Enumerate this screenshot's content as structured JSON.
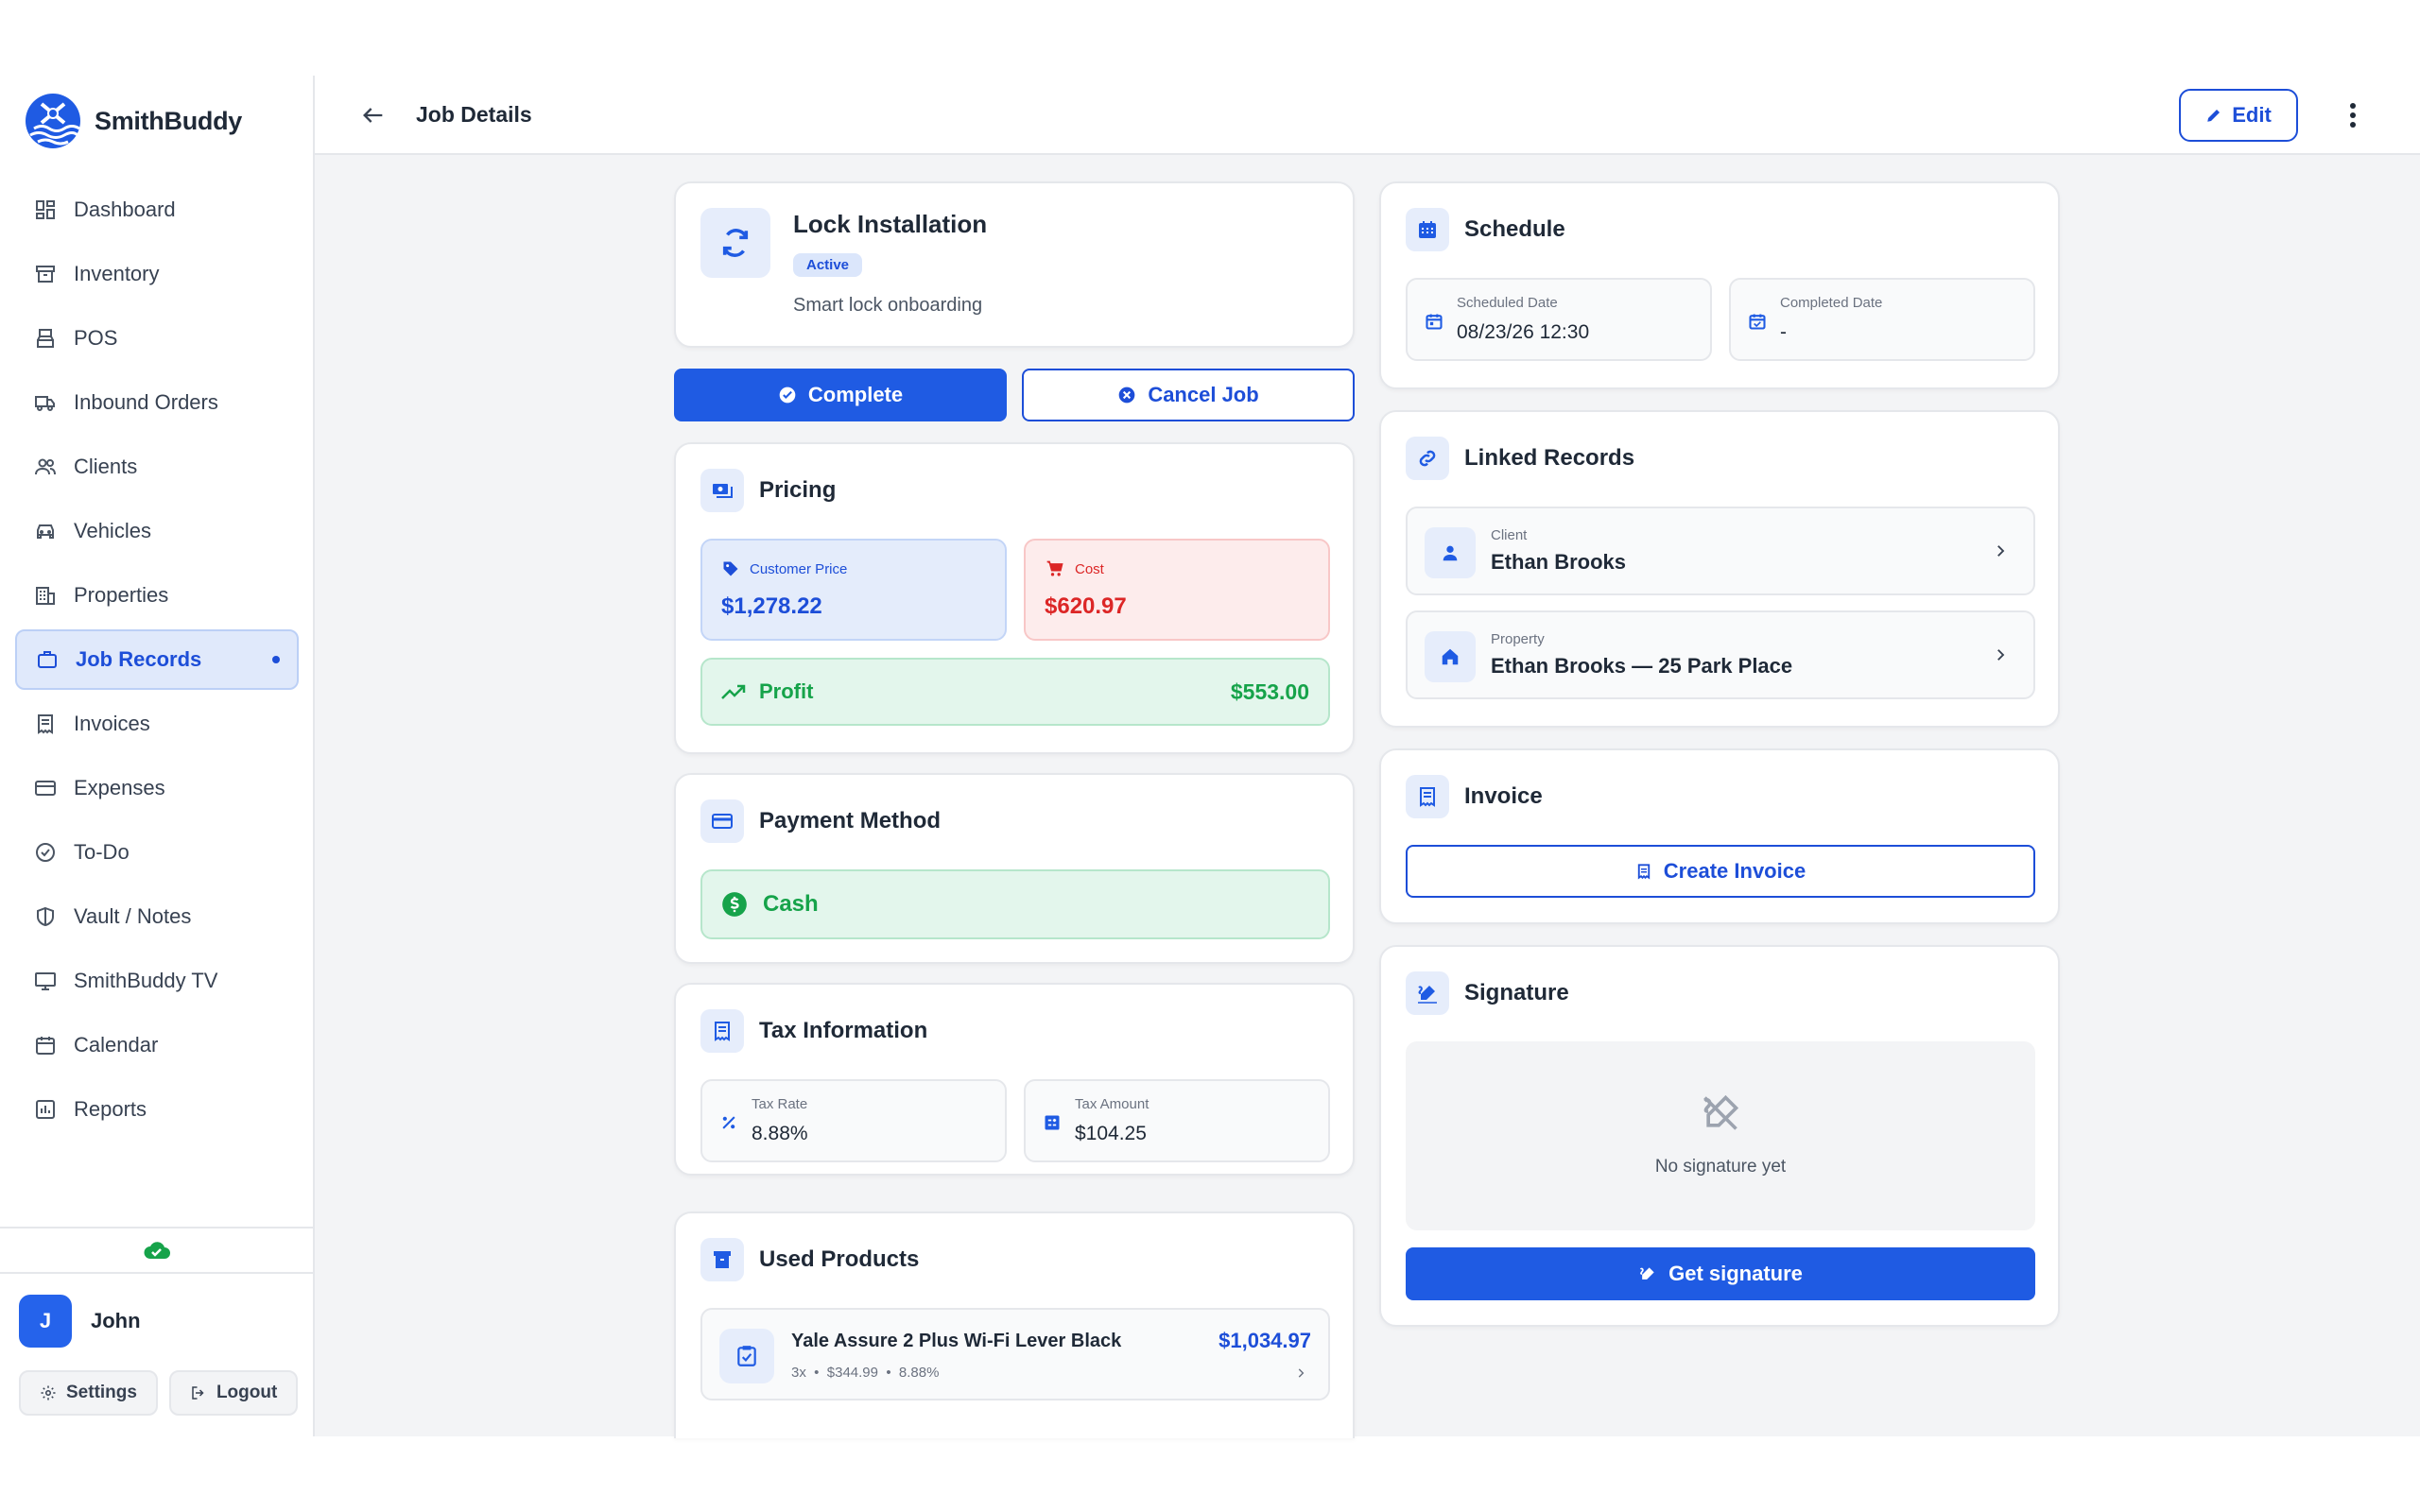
{
  "brand": {
    "name": "SmithBuddy"
  },
  "sidebar": {
    "items": [
      {
        "label": "Dashboard",
        "icon": "dashboard-icon"
      },
      {
        "label": "Inventory",
        "icon": "archive-icon"
      },
      {
        "label": "POS",
        "icon": "register-icon"
      },
      {
        "label": "Inbound Orders",
        "icon": "truck-icon"
      },
      {
        "label": "Clients",
        "icon": "users-icon"
      },
      {
        "label": "Vehicles",
        "icon": "car-icon"
      },
      {
        "label": "Properties",
        "icon": "building-icon"
      },
      {
        "label": "Job Records",
        "icon": "briefcase-icon",
        "active": true
      },
      {
        "label": "Invoices",
        "icon": "receipt-icon"
      },
      {
        "label": "Expenses",
        "icon": "card-icon"
      },
      {
        "label": "To-Do",
        "icon": "check-circle-icon"
      },
      {
        "label": "Vault / Notes",
        "icon": "shield-icon"
      },
      {
        "label": "SmithBuddy TV",
        "icon": "monitor-icon"
      },
      {
        "label": "Calendar",
        "icon": "calendar-icon"
      },
      {
        "label": "Reports",
        "icon": "chart-icon"
      }
    ],
    "user": {
      "initial": "J",
      "name": "John"
    },
    "settings_label": "Settings",
    "logout_label": "Logout"
  },
  "header": {
    "title": "Job Details",
    "edit_label": "Edit"
  },
  "job": {
    "title": "Lock Installation",
    "status": "Active",
    "description": "Smart lock onboarding"
  },
  "actions": {
    "complete_label": "Complete",
    "cancel_label": "Cancel Job"
  },
  "pricing": {
    "title": "Pricing",
    "customer_price_label": "Customer Price",
    "customer_price": "$1,278.22",
    "cost_label": "Cost",
    "cost": "$620.97",
    "profit_label": "Profit",
    "profit": "$553.00"
  },
  "payment": {
    "title": "Payment Method",
    "method": "Cash"
  },
  "tax": {
    "title": "Tax Information",
    "rate_label": "Tax Rate",
    "rate": "8.88%",
    "amount_label": "Tax Amount",
    "amount": "$104.25"
  },
  "products": {
    "title": "Used Products",
    "items": [
      {
        "name": "Yale Assure 2 Plus Wi-Fi Lever Black",
        "details": "3x  •  $344.99  •  8.88%",
        "total": "$1,034.97"
      }
    ]
  },
  "schedule": {
    "title": "Schedule",
    "scheduled_label": "Scheduled Date",
    "scheduled": "08/23/26 12:30",
    "completed_label": "Completed Date",
    "completed": "-"
  },
  "linked": {
    "title": "Linked Records",
    "client_label": "Client",
    "client": "Ethan Brooks",
    "property_label": "Property",
    "property": "Ethan Brooks — 25 Park Place"
  },
  "invoice": {
    "title": "Invoice",
    "create_label": "Create Invoice"
  },
  "signature": {
    "title": "Signature",
    "empty_text": "No signature yet",
    "get_label": "Get signature"
  },
  "colors": {
    "primary": "#1f5be3",
    "profit": "#16a34a",
    "cost": "#dc2626",
    "active_bg": "#e0e9fb"
  }
}
